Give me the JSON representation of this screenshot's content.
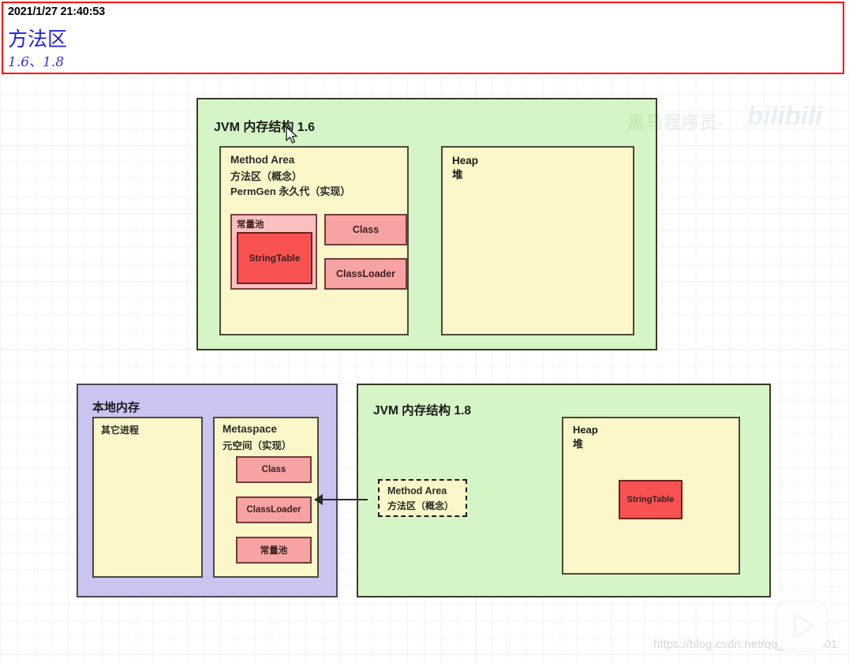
{
  "header": {
    "timestamp": "2021/1/27 21:40:53",
    "title": "方法区",
    "subtitle": "1.6、1.8"
  },
  "diagram_16": {
    "panel_title": "JVM 内存结构 1.6",
    "method_area": {
      "line1": "Method Area",
      "line2": "方法区（概念）",
      "line3": "PermGen 永久代（实现）",
      "constant_pool_label": "常量池",
      "string_table_label": "StringTable",
      "class_label": "Class",
      "classloader_label": "ClassLoader"
    },
    "heap": {
      "line1": "Heap",
      "line2": "堆"
    }
  },
  "diagram_18": {
    "native_memory": {
      "panel_title": "本地内存",
      "other_process_label": "其它进程",
      "metaspace": {
        "line1": "Metaspace",
        "line2": "元空间（实现）",
        "class_label": "Class",
        "classloader_label": "ClassLoader",
        "constant_pool_label": "常量池"
      }
    },
    "jvm": {
      "panel_title": "JVM 内存结构 1.8",
      "method_area_concept": {
        "line1": "Method Area",
        "line2": "方法区（概念）"
      },
      "heap": {
        "line1": "Heap",
        "line2": "堆",
        "string_table_label": "StringTable"
      }
    }
  },
  "watermarks": {
    "bilibili_text": "黑马程序员-",
    "bilibili_logo": "bilibili",
    "csdn_url": "https://blog.csdn.net/qq_24654501"
  },
  "colors": {
    "header_border": "#ff0000",
    "header_title": "#2020dd",
    "green_panel": "#d6f5c6",
    "purple_panel": "#c9c4f0",
    "yellow_box": "#fbf7c8",
    "pink_box": "#f7a3a3",
    "red_box": "#f85252"
  }
}
